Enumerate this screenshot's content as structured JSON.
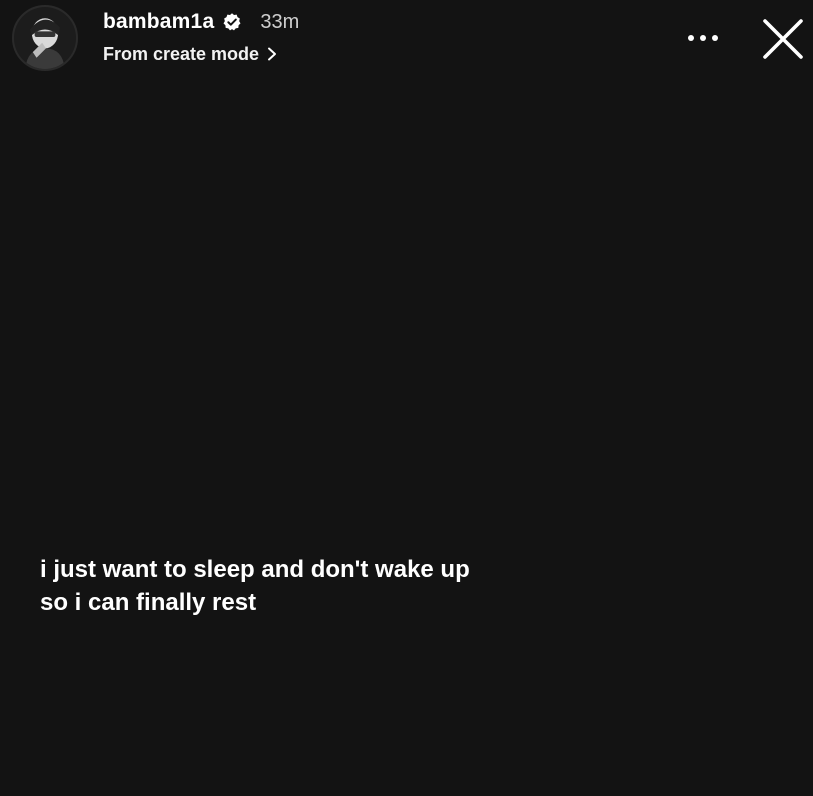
{
  "story": {
    "header": {
      "avatar_icon": "profile-avatar",
      "username": "bambam1a",
      "verified_icon": "verified-badge-icon",
      "time_ago": "33m",
      "subtitle": "From create mode",
      "subtitle_icon": "chevron-right-icon",
      "more_icon": "more-horizontal-icon",
      "close_icon": "close-icon"
    },
    "text_lines": [
      "i just want to sleep and don't wake up",
      "so i can finally rest"
    ],
    "colors": {
      "background": "#131313",
      "text": "#ffffff",
      "secondary_text": "#cfcfcf"
    }
  }
}
